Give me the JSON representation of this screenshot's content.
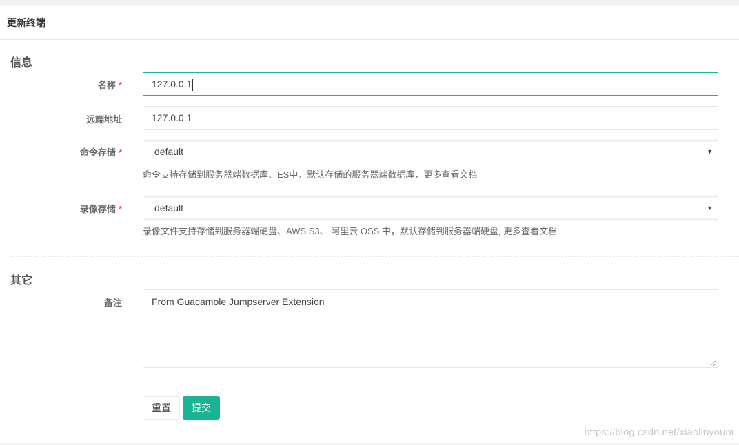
{
  "page": {
    "title": "更新终端"
  },
  "sections": {
    "info": "信息",
    "other": "其它"
  },
  "form": {
    "name": {
      "label": "名称",
      "required": "*",
      "value": "127.0.0.1"
    },
    "remote_addr": {
      "label": "远端地址",
      "value": "127.0.0.1"
    },
    "command_storage": {
      "label": "命令存储",
      "required": "*",
      "value": "default",
      "help": "命令支持存储到服务器端数据库、ES中，默认存储的服务器端数据库，更多查看文档"
    },
    "replay_storage": {
      "label": "录像存储",
      "required": "*",
      "value": "default",
      "help": "录像文件支持存储到服务器端硬盘、AWS S3、 阿里云 OSS 中，默认存储到服务器端硬盘, 更多查看文档"
    },
    "comment": {
      "label": "备注",
      "value": "From Guacamole Jumpserver Extension"
    }
  },
  "buttons": {
    "reset": "重置",
    "submit": "提交"
  },
  "watermark": "https://blog.csdn.net/xiaolinyouni",
  "icons": {
    "select_arrow": "▼"
  },
  "colors": {
    "primary": "#1ab394",
    "required": "#ed5565",
    "focus_border": "#1ab394"
  }
}
